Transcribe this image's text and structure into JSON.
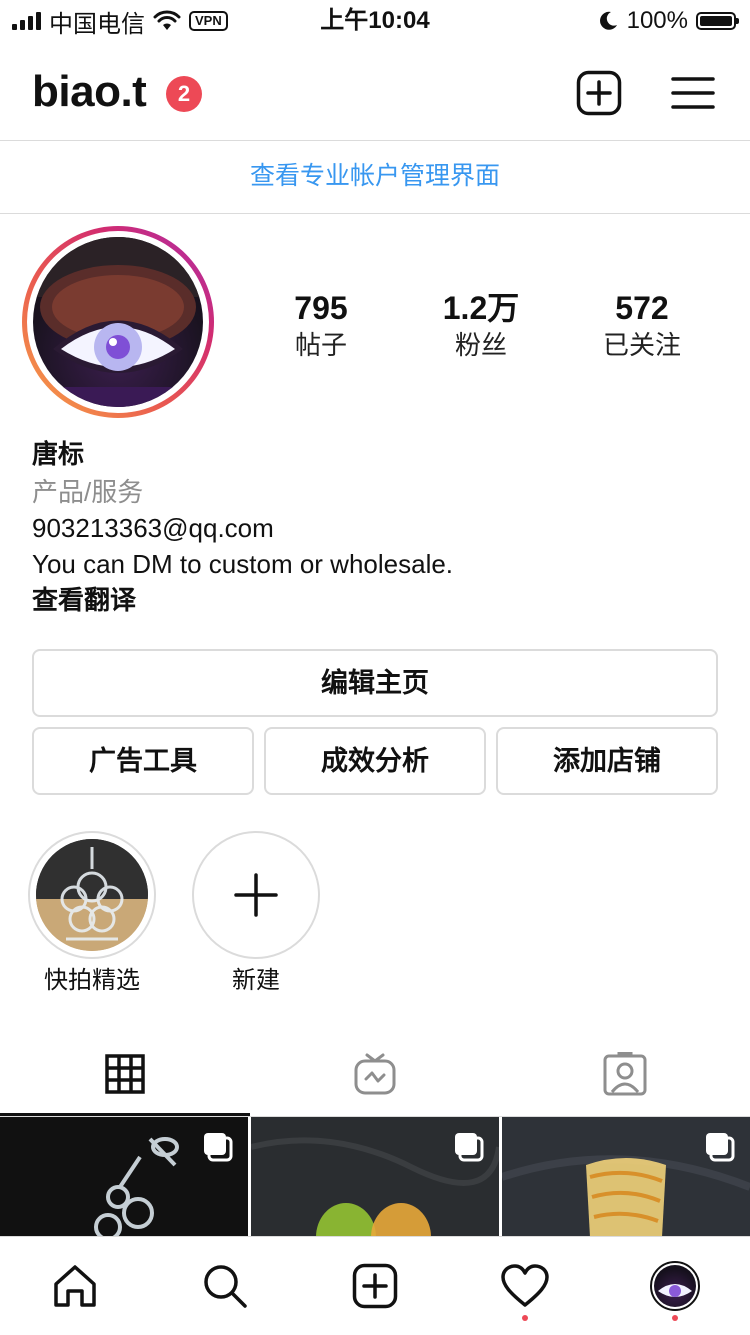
{
  "status_bar": {
    "carrier": "中国电信",
    "vpn": "VPN",
    "time": "上午10:04",
    "battery": "100%"
  },
  "header": {
    "username": "biao.t",
    "notification_count": "2",
    "icons": [
      "new-post-icon",
      "menu-icon"
    ]
  },
  "professional_dashboard": "查看专业帐户管理界面",
  "profile": {
    "stats": [
      {
        "value": "795",
        "label": "帖子"
      },
      {
        "value": "1.2万",
        "label": "粉丝"
      },
      {
        "value": "572",
        "label": "已关注"
      }
    ],
    "name": "唐标",
    "category": "产品/服务",
    "email": "903213363@qq.com",
    "bio": "You can DM to custom or wholesale.",
    "translate": "查看翻译"
  },
  "buttons": {
    "edit_profile": "编辑主页",
    "ad_tools": "广告工具",
    "insights": "成效分析",
    "add_shop": "添加店铺"
  },
  "highlights": [
    {
      "label": "快拍精选"
    },
    {
      "label": "新建"
    }
  ],
  "tabs": [
    "grid-icon",
    "igtv-icon",
    "tagged-icon"
  ],
  "bottom_nav": [
    "home-icon",
    "search-icon",
    "add-icon",
    "heart-icon",
    "profile-avatar"
  ],
  "colors": {
    "accent_blue": "#3897f0",
    "badge_red": "#ed4956",
    "border": "#dbdbdb",
    "muted_text": "#8e8e8e"
  }
}
